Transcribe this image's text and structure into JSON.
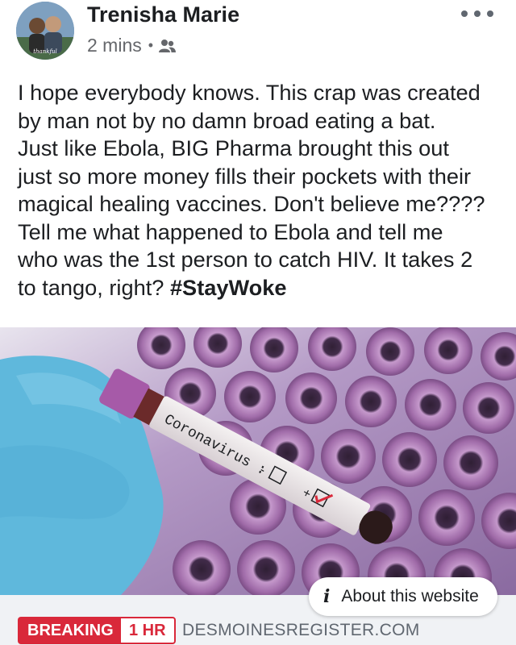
{
  "post": {
    "author": "Trenisha Marie",
    "timestamp": "2 mins",
    "audience_icon": "friends-icon",
    "more_icon": "more-options-icon",
    "text_lines": [
      "I hope everybody knows. This crap was created",
      "by man not by no damn broad eating a bat.",
      "Just like Ebola, BIG Pharma brought this out",
      "just so more money fills their pockets with their",
      "magical healing vaccines. Don't believe me????",
      "Tell me what happened to Ebola and tell me",
      "who was the 1st person to catch HIV. It takes 2"
    ],
    "last_line_prefix": "to tango, right? ",
    "hashtag": "#StayWoke"
  },
  "media": {
    "tube_label": "Coronavirus :",
    "negative_mark": "-",
    "positive_mark": "+",
    "colors": {
      "glove": "#5fb8dc",
      "cap": "#a65aa8",
      "background": "#9b7fb8",
      "check": "#d9283a"
    }
  },
  "link": {
    "about_label": "About this website",
    "about_icon": "info-icon",
    "breaking_label": "BREAKING",
    "time_label": "1 HR",
    "domain": "DESMOINESREGISTER.COM",
    "accent_color": "#d9283a"
  }
}
